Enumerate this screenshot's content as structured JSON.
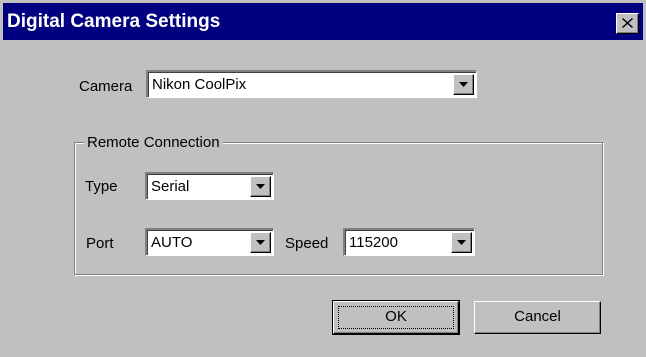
{
  "window": {
    "title": "Digital Camera Settings"
  },
  "camera": {
    "label": "Camera",
    "value": "Nikon CoolPix"
  },
  "remote_connection": {
    "legend": "Remote Connection",
    "type": {
      "label": "Type",
      "value": "Serial"
    },
    "port": {
      "label": "Port",
      "value": "AUTO"
    },
    "speed": {
      "label": "Speed",
      "value": "115200"
    }
  },
  "buttons": {
    "ok": "OK",
    "cancel": "Cancel"
  },
  "icons": {
    "close": "close-icon",
    "dropdown": "chevron-down-icon"
  },
  "colors": {
    "titlebar": "#000080",
    "face": "#c0c0c0"
  }
}
